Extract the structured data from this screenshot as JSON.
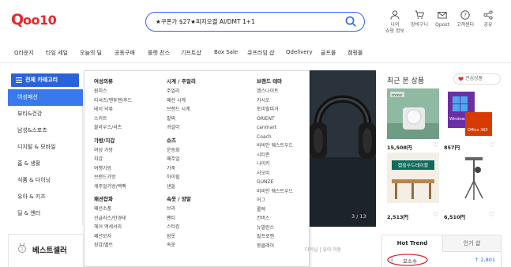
{
  "header": {
    "logo_text": "Qoo10",
    "search_value": "★쿠폰가 $27★피지오겔 AI/DMT 1+1",
    "utilities": [
      {
        "icon": "user-icon",
        "label_line1": "나의",
        "label_line2": "쇼핑 정보"
      },
      {
        "icon": "cart-icon",
        "label_line1": "장바구니",
        "label_line2": ""
      },
      {
        "icon": "mail-icon",
        "label_line1": "Qpost",
        "label_line2": ""
      },
      {
        "icon": "help-icon",
        "label_line1": "고객센터",
        "label_line2": ""
      },
      {
        "icon": "share-icon",
        "label_line1": "공유",
        "label_line2": ""
      }
    ]
  },
  "nav": {
    "items": [
      "Q라운지",
      "타임 세일",
      "오늘의 딜",
      "공동구매",
      "룰렛 찬스",
      "기프트샵",
      "Box Sale",
      "큐프라임 샵",
      "Qdelivery",
      "골프몰",
      "캠핑몰"
    ]
  },
  "categories": {
    "all_label": "전체 카테고리",
    "items": [
      "여성패션",
      "뷰티&건강",
      "남성&스포츠",
      "디지털 & 모바일",
      "홈 & 생활",
      "식품 & 다이닝",
      "유아 & 키즈",
      "딜 & 엔터"
    ],
    "active_index": 0
  },
  "dropdown": {
    "col1": [
      {
        "heading": "여성의류",
        "items": [
          "원피스",
          "티셔츠/맨투맨/후드",
          "테이 의류",
          "스커트",
          "블라우스/셔츠"
        ]
      },
      {
        "heading": "가방/지갑",
        "items": [
          "여성 가방",
          "지갑",
          "여행가방",
          "브랜드가방",
          "캐주얼가방/백팩"
        ]
      },
      {
        "heading": "패션잡화",
        "items": [
          "패션소품",
          "선글라스/안경테",
          "헤어 액세서리",
          "패션모자",
          "장갑/벨트"
        ]
      }
    ],
    "col2": [
      {
        "heading": "시계 / 주얼리",
        "items": [
          "주얼리",
          "패션 시계",
          "브랜드 시계",
          "팔찌",
          "귀걸이"
        ]
      },
      {
        "heading": "슈즈",
        "items": [
          "운동화",
          "패주얼",
          "가죽",
          "하이힐",
          "샌들"
        ]
      },
      {
        "heading": "속옷 / 양말",
        "items": [
          "브라",
          "팬티",
          "스타킹",
          "잠옷",
          "속옷"
        ]
      }
    ],
    "col3": {
      "heading": "브랜드 테마",
      "items": [
        "엠스나이트",
        "카시오",
        "토미힐피거",
        "ORIENT",
        "canmart",
        "Coach",
        "비비안 웨스트우드",
        "시티즌",
        "나이키",
        "사오미",
        "GUNZE",
        "비비안 웨스트우드",
        "어그",
        "롤렉",
        "컨버스",
        "뉴발란스",
        "릴프로렌",
        "몽클레어"
      ]
    }
  },
  "banner": {
    "counter": "3 / 13"
  },
  "recent": {
    "title": "최근 본 상품",
    "fav_label": "관심상품",
    "items": [
      {
        "name": "mini-fan-product",
        "brand_text": "mmo",
        "price": "15,508円"
      },
      {
        "name": "windows-10-pro-product",
        "brand_text": "Windows 10 Pro",
        "brand_text2": "Office 365",
        "price": "857円"
      },
      {
        "name": "camping-table-product",
        "brand_text": "캠핑우드테이블",
        "price": "2,513円"
      },
      {
        "name": "camera-tripod-product",
        "brand_text": "",
        "price": "6,510円"
      }
    ]
  },
  "bestseller": {
    "title": "베스트셀러",
    "sub": "다이닝 | 유아 아동"
  },
  "trend": {
    "tabs": [
      "Hot Trend",
      "인기 샵"
    ],
    "active_tab": 0,
    "rows": [
      {
        "rank": "1",
        "keyword": "모소수",
        "change": "↑ 2,801"
      }
    ]
  },
  "colors": {
    "brand_blue": "#2a63d8",
    "active_blue": "#3a78ee",
    "qoo_red": "#e8262b",
    "trend_red": "#d42b2b"
  }
}
